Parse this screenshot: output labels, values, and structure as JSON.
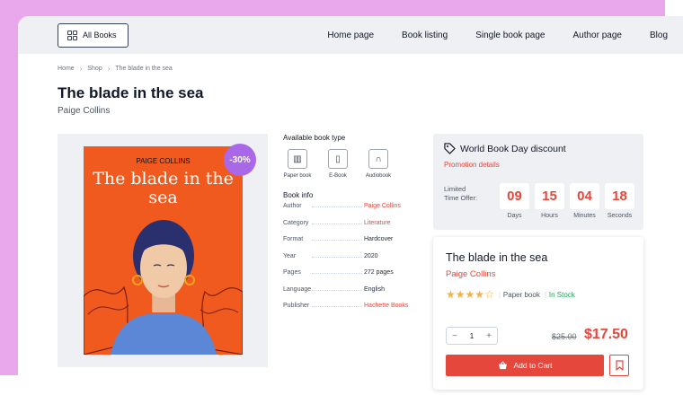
{
  "topbar": {
    "all_books_label": "All Books",
    "nav": [
      "Home page",
      "Book listing",
      "Single book page",
      "Author page",
      "Blog"
    ]
  },
  "breadcrumb": [
    "Home",
    "Shop",
    "The blade in the sea"
  ],
  "book": {
    "title": "The blade in the sea",
    "author": "Paige Collins",
    "cover_author": "PAIGE COLLINS",
    "cover_title": "The blade in the sea",
    "discount": "-30%"
  },
  "book_types": {
    "heading": "Available book type",
    "items": [
      {
        "label": "Paper book",
        "icon": "paper-book-icon"
      },
      {
        "label": "E-Book",
        "icon": "ebook-icon"
      },
      {
        "label": "Audiobook",
        "icon": "headphones-icon"
      }
    ]
  },
  "book_info": {
    "heading": "Book info",
    "rows": [
      {
        "key": "Author",
        "value": "Paige Collins"
      },
      {
        "key": "Category",
        "value": "Literature"
      },
      {
        "key": "Format",
        "value": "Hardcover"
      },
      {
        "key": "Year",
        "value": "2020"
      },
      {
        "key": "Pages",
        "value": "272 pages"
      },
      {
        "key": "Language",
        "value": "English"
      },
      {
        "key": "Publisher",
        "value": "Hachette Books"
      }
    ]
  },
  "promo": {
    "title": "World Book Day discount",
    "link": "Promotion details",
    "label_line1": "Limited",
    "label_line2": "Time Offer:",
    "countdown": [
      {
        "value": "09",
        "unit": "Days"
      },
      {
        "value": "15",
        "unit": "Hours"
      },
      {
        "value": "04",
        "unit": "Minutes"
      },
      {
        "value": "18",
        "unit": "Seconds"
      }
    ]
  },
  "purchase": {
    "title": "The blade in the sea",
    "author": "Paige Collins",
    "rating": 4,
    "rating_max": 5,
    "type": "Paper book",
    "stock": "In Stock",
    "quantity": "1",
    "minus": "−",
    "plus": "+",
    "old_price": "$25.00",
    "new_price": "$17.50",
    "cart_label": "Add to Cart"
  },
  "colors": {
    "accent": "#e5473c",
    "badge": "#a868e8",
    "frame": "#e9a7ec",
    "cover": "#f05a1e",
    "in_stock": "#22a35a",
    "star": "#f5b041"
  }
}
